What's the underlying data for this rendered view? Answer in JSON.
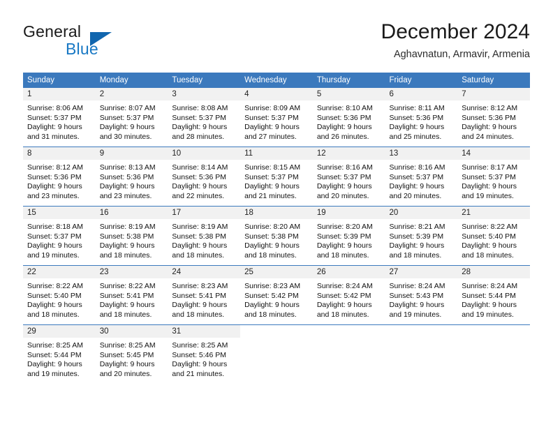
{
  "brand": {
    "name_part1": "General",
    "name_part2": "Blue",
    "triangle_color": "#1166ae",
    "blue_text_color": "#1878c4"
  },
  "header": {
    "title": "December 2024",
    "subtitle": "Aghavnatun, Armavir, Armenia"
  },
  "theme": {
    "header_bg": "#3b79bd",
    "daynum_bg": "#f1f1f1",
    "row_divider": "#3b79bd"
  },
  "weekday_headers": [
    "Sunday",
    "Monday",
    "Tuesday",
    "Wednesday",
    "Thursday",
    "Friday",
    "Saturday"
  ],
  "weeks": [
    {
      "days": [
        {
          "num": "1",
          "sunrise": "Sunrise: 8:06 AM",
          "sunset": "Sunset: 5:37 PM",
          "daylight_1": "Daylight: 9 hours",
          "daylight_2": "and 31 minutes."
        },
        {
          "num": "2",
          "sunrise": "Sunrise: 8:07 AM",
          "sunset": "Sunset: 5:37 PM",
          "daylight_1": "Daylight: 9 hours",
          "daylight_2": "and 30 minutes."
        },
        {
          "num": "3",
          "sunrise": "Sunrise: 8:08 AM",
          "sunset": "Sunset: 5:37 PM",
          "daylight_1": "Daylight: 9 hours",
          "daylight_2": "and 28 minutes."
        },
        {
          "num": "4",
          "sunrise": "Sunrise: 8:09 AM",
          "sunset": "Sunset: 5:37 PM",
          "daylight_1": "Daylight: 9 hours",
          "daylight_2": "and 27 minutes."
        },
        {
          "num": "5",
          "sunrise": "Sunrise: 8:10 AM",
          "sunset": "Sunset: 5:36 PM",
          "daylight_1": "Daylight: 9 hours",
          "daylight_2": "and 26 minutes."
        },
        {
          "num": "6",
          "sunrise": "Sunrise: 8:11 AM",
          "sunset": "Sunset: 5:36 PM",
          "daylight_1": "Daylight: 9 hours",
          "daylight_2": "and 25 minutes."
        },
        {
          "num": "7",
          "sunrise": "Sunrise: 8:12 AM",
          "sunset": "Sunset: 5:36 PM",
          "daylight_1": "Daylight: 9 hours",
          "daylight_2": "and 24 minutes."
        }
      ]
    },
    {
      "days": [
        {
          "num": "8",
          "sunrise": "Sunrise: 8:12 AM",
          "sunset": "Sunset: 5:36 PM",
          "daylight_1": "Daylight: 9 hours",
          "daylight_2": "and 23 minutes."
        },
        {
          "num": "9",
          "sunrise": "Sunrise: 8:13 AM",
          "sunset": "Sunset: 5:36 PM",
          "daylight_1": "Daylight: 9 hours",
          "daylight_2": "and 23 minutes."
        },
        {
          "num": "10",
          "sunrise": "Sunrise: 8:14 AM",
          "sunset": "Sunset: 5:36 PM",
          "daylight_1": "Daylight: 9 hours",
          "daylight_2": "and 22 minutes."
        },
        {
          "num": "11",
          "sunrise": "Sunrise: 8:15 AM",
          "sunset": "Sunset: 5:37 PM",
          "daylight_1": "Daylight: 9 hours",
          "daylight_2": "and 21 minutes."
        },
        {
          "num": "12",
          "sunrise": "Sunrise: 8:16 AM",
          "sunset": "Sunset: 5:37 PM",
          "daylight_1": "Daylight: 9 hours",
          "daylight_2": "and 20 minutes."
        },
        {
          "num": "13",
          "sunrise": "Sunrise: 8:16 AM",
          "sunset": "Sunset: 5:37 PM",
          "daylight_1": "Daylight: 9 hours",
          "daylight_2": "and 20 minutes."
        },
        {
          "num": "14",
          "sunrise": "Sunrise: 8:17 AM",
          "sunset": "Sunset: 5:37 PM",
          "daylight_1": "Daylight: 9 hours",
          "daylight_2": "and 19 minutes."
        }
      ]
    },
    {
      "days": [
        {
          "num": "15",
          "sunrise": "Sunrise: 8:18 AM",
          "sunset": "Sunset: 5:37 PM",
          "daylight_1": "Daylight: 9 hours",
          "daylight_2": "and 19 minutes."
        },
        {
          "num": "16",
          "sunrise": "Sunrise: 8:19 AM",
          "sunset": "Sunset: 5:38 PM",
          "daylight_1": "Daylight: 9 hours",
          "daylight_2": "and 18 minutes."
        },
        {
          "num": "17",
          "sunrise": "Sunrise: 8:19 AM",
          "sunset": "Sunset: 5:38 PM",
          "daylight_1": "Daylight: 9 hours",
          "daylight_2": "and 18 minutes."
        },
        {
          "num": "18",
          "sunrise": "Sunrise: 8:20 AM",
          "sunset": "Sunset: 5:38 PM",
          "daylight_1": "Daylight: 9 hours",
          "daylight_2": "and 18 minutes."
        },
        {
          "num": "19",
          "sunrise": "Sunrise: 8:20 AM",
          "sunset": "Sunset: 5:39 PM",
          "daylight_1": "Daylight: 9 hours",
          "daylight_2": "and 18 minutes."
        },
        {
          "num": "20",
          "sunrise": "Sunrise: 8:21 AM",
          "sunset": "Sunset: 5:39 PM",
          "daylight_1": "Daylight: 9 hours",
          "daylight_2": "and 18 minutes."
        },
        {
          "num": "21",
          "sunrise": "Sunrise: 8:22 AM",
          "sunset": "Sunset: 5:40 PM",
          "daylight_1": "Daylight: 9 hours",
          "daylight_2": "and 18 minutes."
        }
      ]
    },
    {
      "days": [
        {
          "num": "22",
          "sunrise": "Sunrise: 8:22 AM",
          "sunset": "Sunset: 5:40 PM",
          "daylight_1": "Daylight: 9 hours",
          "daylight_2": "and 18 minutes."
        },
        {
          "num": "23",
          "sunrise": "Sunrise: 8:22 AM",
          "sunset": "Sunset: 5:41 PM",
          "daylight_1": "Daylight: 9 hours",
          "daylight_2": "and 18 minutes."
        },
        {
          "num": "24",
          "sunrise": "Sunrise: 8:23 AM",
          "sunset": "Sunset: 5:41 PM",
          "daylight_1": "Daylight: 9 hours",
          "daylight_2": "and 18 minutes."
        },
        {
          "num": "25",
          "sunrise": "Sunrise: 8:23 AM",
          "sunset": "Sunset: 5:42 PM",
          "daylight_1": "Daylight: 9 hours",
          "daylight_2": "and 18 minutes."
        },
        {
          "num": "26",
          "sunrise": "Sunrise: 8:24 AM",
          "sunset": "Sunset: 5:42 PM",
          "daylight_1": "Daylight: 9 hours",
          "daylight_2": "and 18 minutes."
        },
        {
          "num": "27",
          "sunrise": "Sunrise: 8:24 AM",
          "sunset": "Sunset: 5:43 PM",
          "daylight_1": "Daylight: 9 hours",
          "daylight_2": "and 19 minutes."
        },
        {
          "num": "28",
          "sunrise": "Sunrise: 8:24 AM",
          "sunset": "Sunset: 5:44 PM",
          "daylight_1": "Daylight: 9 hours",
          "daylight_2": "and 19 minutes."
        }
      ]
    },
    {
      "days": [
        {
          "num": "29",
          "sunrise": "Sunrise: 8:25 AM",
          "sunset": "Sunset: 5:44 PM",
          "daylight_1": "Daylight: 9 hours",
          "daylight_2": "and 19 minutes."
        },
        {
          "num": "30",
          "sunrise": "Sunrise: 8:25 AM",
          "sunset": "Sunset: 5:45 PM",
          "daylight_1": "Daylight: 9 hours",
          "daylight_2": "and 20 minutes."
        },
        {
          "num": "31",
          "sunrise": "Sunrise: 8:25 AM",
          "sunset": "Sunset: 5:46 PM",
          "daylight_1": "Daylight: 9 hours",
          "daylight_2": "and 21 minutes."
        },
        {
          "num": "",
          "sunrise": "",
          "sunset": "",
          "daylight_1": "",
          "daylight_2": ""
        },
        {
          "num": "",
          "sunrise": "",
          "sunset": "",
          "daylight_1": "",
          "daylight_2": ""
        },
        {
          "num": "",
          "sunrise": "",
          "sunset": "",
          "daylight_1": "",
          "daylight_2": ""
        },
        {
          "num": "",
          "sunrise": "",
          "sunset": "",
          "daylight_1": "",
          "daylight_2": ""
        }
      ]
    }
  ]
}
